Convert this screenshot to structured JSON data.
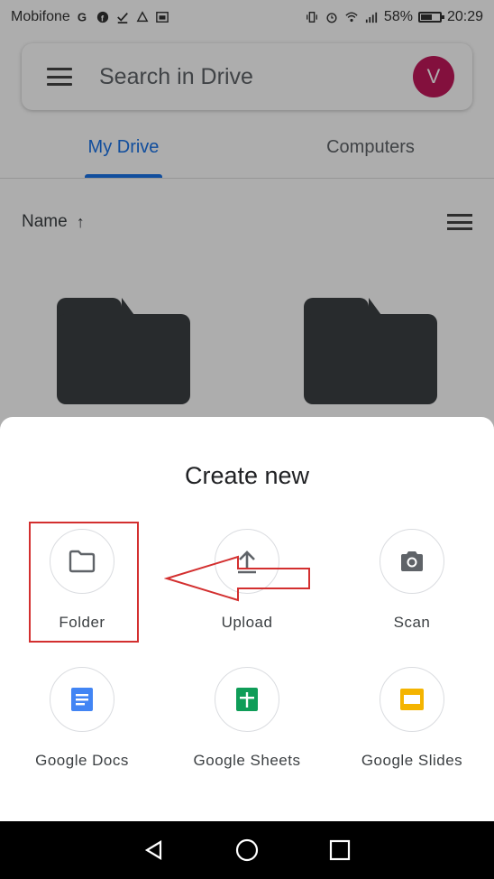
{
  "status_bar": {
    "carrier": "Mobifone",
    "battery_percent": "58%",
    "time": "20:29"
  },
  "search": {
    "placeholder": "Search in Drive",
    "avatar_initial": "V",
    "avatar_color": "#c2185b"
  },
  "tabs": [
    {
      "label": "My Drive",
      "active": true
    },
    {
      "label": "Computers",
      "active": false
    }
  ],
  "sort": {
    "label": "Name",
    "direction_icon": "arrow-up-icon"
  },
  "sheet": {
    "title": "Create new",
    "actions": [
      {
        "label": "Folder",
        "icon": "folder-outline-icon"
      },
      {
        "label": "Upload",
        "icon": "upload-icon"
      },
      {
        "label": "Scan",
        "icon": "camera-icon"
      },
      {
        "label": "Google Docs",
        "icon": "google-docs-icon"
      },
      {
        "label": "Google Sheets",
        "icon": "google-sheets-icon"
      },
      {
        "label": "Google Slides",
        "icon": "google-slides-icon"
      }
    ]
  },
  "colors": {
    "accent": "#1a73e8",
    "annotation": "#d32f2f",
    "docs": "#4285f4",
    "sheets": "#0f9d58",
    "slides": "#f4b400"
  }
}
